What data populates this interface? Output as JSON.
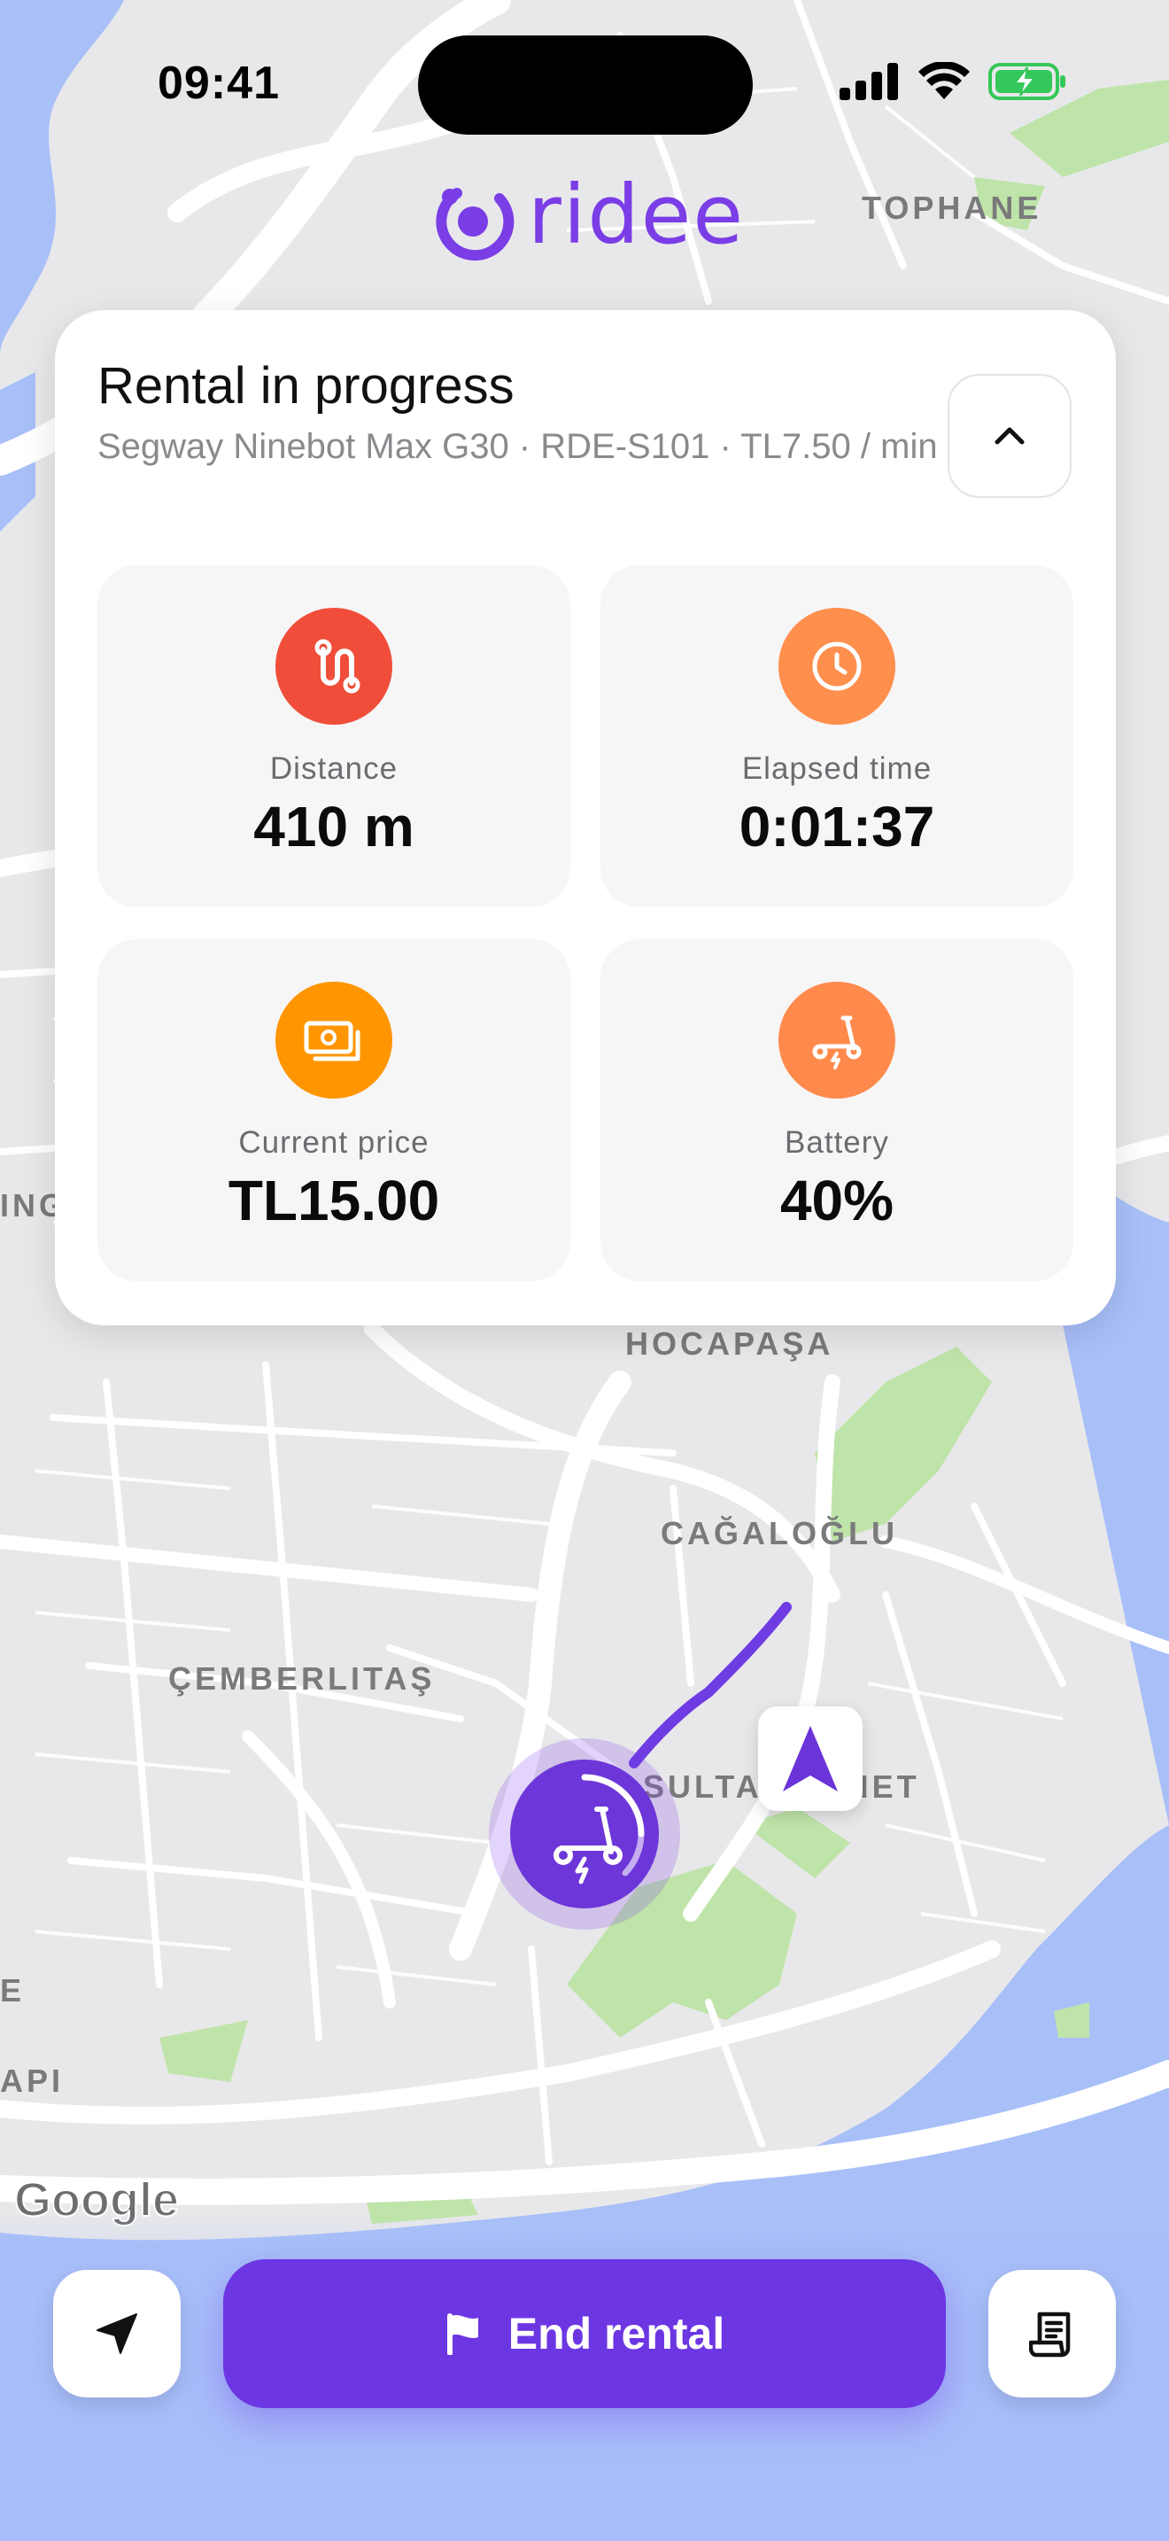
{
  "status_bar": {
    "time": "09:41",
    "icons": [
      "signal-icon",
      "wifi-icon",
      "battery-charging-icon"
    ]
  },
  "brand": {
    "name": "ridee",
    "color": "#7a3de6"
  },
  "map": {
    "labels": {
      "tophane": "TOPHANE",
      "hocapasa": "HOCAPAŞA",
      "cagaloglu": "CAĞALOĞLU",
      "cemberlitas": "ÇEMBERLITAŞ",
      "sultanahmet": "SULTANAHMET",
      "ing": "ING",
      "api": "API",
      "e": "E"
    },
    "attribution": "Google"
  },
  "rental": {
    "title": "Rental in progress",
    "subtitle": "Segway Ninebot Max G30 · RDE-S101 · TL7.50 / min",
    "stats": [
      {
        "label": "Distance",
        "value": "410 m",
        "icon": "route-icon",
        "color": "#f04e3a"
      },
      {
        "label": "Elapsed time",
        "value": "0:01:37",
        "icon": "clock-icon",
        "color": "#ff8f4d"
      },
      {
        "label": "Current price",
        "value": "TL15.00",
        "icon": "cash-icon",
        "color": "#ff9500"
      },
      {
        "label": "Battery",
        "value": "40%",
        "icon": "scooter-icon",
        "color": "#ff8a4c"
      }
    ]
  },
  "actions": {
    "end_rental": "End rental",
    "end_rental_color": "#6c36e3"
  }
}
